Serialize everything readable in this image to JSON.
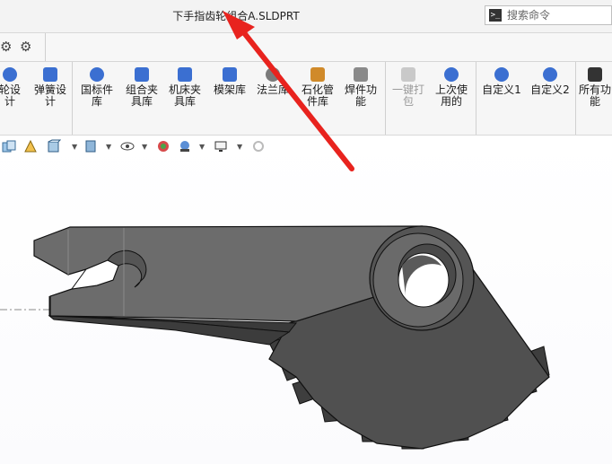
{
  "window": {
    "title": "下手指齿轮组合A.SLDPRT"
  },
  "search": {
    "placeholder": "搜索命令",
    "icon": "terminal-icon"
  },
  "quick_toolbar": {
    "icons": [
      "gear-icon",
      "gear-settings-icon"
    ]
  },
  "ribbon": {
    "buttons": [
      {
        "id": "gear-design",
        "label": "轮设\n计",
        "icon": "gear-design-icon",
        "color": "#3b6fd1",
        "enabled": true
      },
      {
        "id": "spring-design",
        "label": "弹簧设\n计",
        "icon": "spring-icon",
        "color": "#3b6fd1",
        "enabled": true
      },
      {
        "id": "standard-lib",
        "label": "国标件\n库",
        "icon": "bolt-icon",
        "color": "#3b6fd1",
        "enabled": true
      },
      {
        "id": "fixture-combo",
        "label": "组合夹\n具库",
        "icon": "fixture-grid-icon",
        "color": "#3b6fd1",
        "enabled": true
      },
      {
        "id": "machine-fixture",
        "label": "机床夹\n具库",
        "icon": "machine-clamp-icon",
        "color": "#3b6fd1",
        "enabled": true
      },
      {
        "id": "mold-frame",
        "label": "模架库",
        "icon": "mold-frame-icon",
        "color": "#3b6fd1",
        "enabled": true
      },
      {
        "id": "flange",
        "label": "法兰库",
        "icon": "flange-icon",
        "color": "#7a7a7a",
        "enabled": true
      },
      {
        "id": "petro-pipe",
        "label": "石化管\n件库",
        "icon": "pipe-icon",
        "color": "#d08a2a",
        "enabled": true
      },
      {
        "id": "weldment",
        "label": "焊件功\n能",
        "icon": "weld-icon",
        "color": "#8a8a8a",
        "enabled": true
      },
      {
        "id": "pack",
        "label": "一键打\n包",
        "icon": "pack-icon",
        "color": "#9a9a9a",
        "enabled": false
      },
      {
        "id": "last-used",
        "label": "上次使\n用的",
        "icon": "history-icon",
        "color": "#3b6fd1",
        "enabled": true
      },
      {
        "id": "custom1",
        "label": "自定义1",
        "icon": "user-icon",
        "color": "#3b6fd1",
        "enabled": true
      },
      {
        "id": "custom2",
        "label": "自定义2",
        "icon": "user-icon",
        "color": "#3b6fd1",
        "enabled": true
      },
      {
        "id": "all-functions",
        "label": "所有功\n能",
        "icon": "box-icon",
        "color": "#333333",
        "enabled": true
      }
    ]
  },
  "heads_up_toolbar": {
    "icons": [
      "section-view-icon",
      "view-orient-icon",
      "display-style-icon",
      "hide-show-icon",
      "edit-appearance-icon",
      "apply-scene-icon",
      "view-settings-icon",
      "rotate-view-icon"
    ]
  },
  "viewport": {
    "model": "gear-finger-part",
    "model_color": "#555555",
    "annotation": "red-arrow"
  }
}
